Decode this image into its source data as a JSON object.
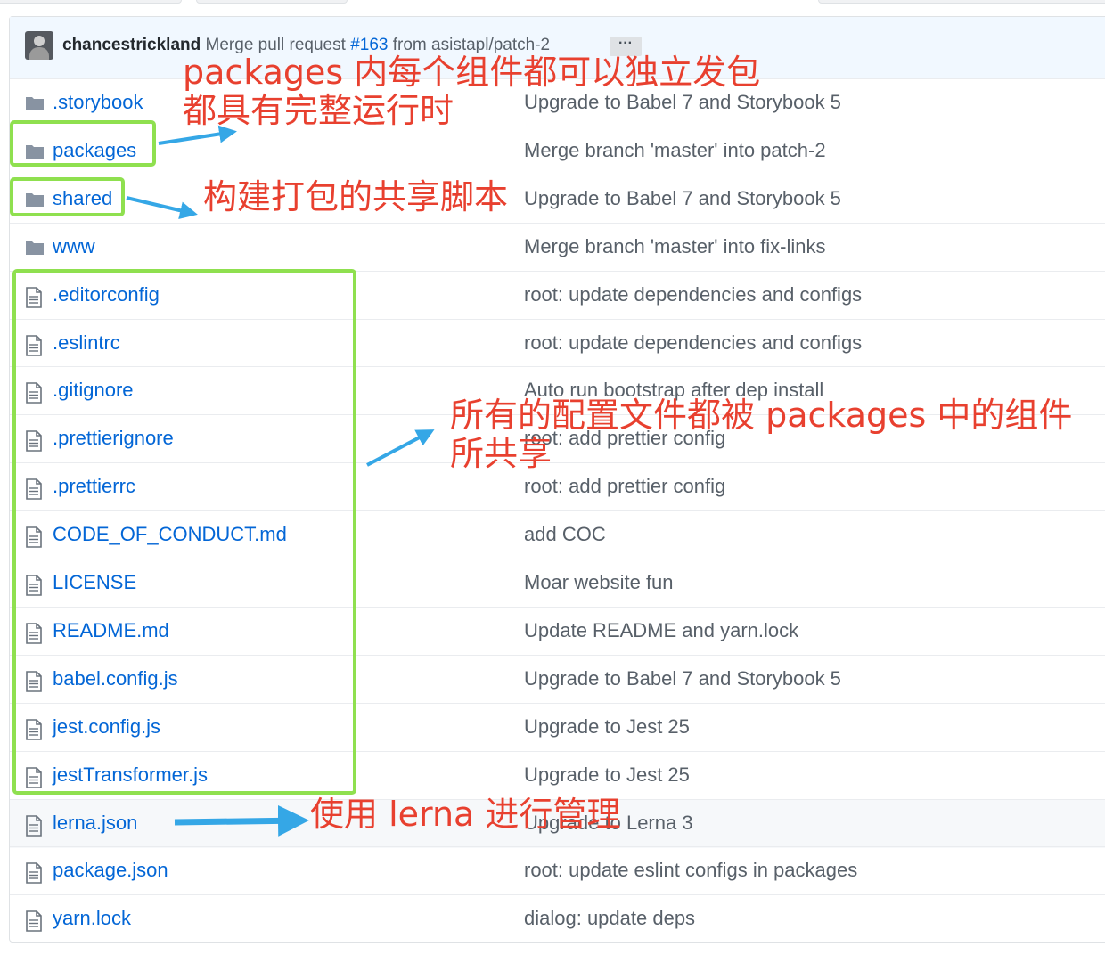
{
  "commit": {
    "author": "chancestrickland",
    "message_prefix": "Merge pull request",
    "pr_number": "#163",
    "message_suffix": "from asistapl/patch-2",
    "more_label": "···"
  },
  "files": [
    {
      "name": ".storybook",
      "type": "folder",
      "message": "Upgrade to Babel 7 and Storybook 5"
    },
    {
      "name": "packages",
      "type": "folder",
      "message": "Merge branch 'master' into patch-2"
    },
    {
      "name": "shared",
      "type": "folder",
      "message": "Upgrade to Babel 7 and Storybook 5"
    },
    {
      "name": "www",
      "type": "folder",
      "message": "Merge branch 'master' into fix-links"
    },
    {
      "name": ".editorconfig",
      "type": "file",
      "message": "root: update dependencies and configs"
    },
    {
      "name": ".eslintrc",
      "type": "file",
      "message": "root: update dependencies and configs"
    },
    {
      "name": ".gitignore",
      "type": "file",
      "message": "Auto run bootstrap after dep install"
    },
    {
      "name": ".prettierignore",
      "type": "file",
      "message": "root: add prettier config"
    },
    {
      "name": ".prettierrc",
      "type": "file",
      "message": "root: add prettier config"
    },
    {
      "name": "CODE_OF_CONDUCT.md",
      "type": "file",
      "message": "add COC"
    },
    {
      "name": "LICENSE",
      "type": "file",
      "message": "Moar website fun"
    },
    {
      "name": "README.md",
      "type": "file",
      "message": "Update README and yarn.lock"
    },
    {
      "name": "babel.config.js",
      "type": "file",
      "message": "Upgrade to Babel 7 and Storybook 5"
    },
    {
      "name": "jest.config.js",
      "type": "file",
      "message": "Upgrade to Jest 25"
    },
    {
      "name": "jestTransformer.js",
      "type": "file",
      "message": "Upgrade to Jest 25"
    },
    {
      "name": "lerna.json",
      "type": "file",
      "message": "Upgrade to Lerna 3"
    },
    {
      "name": "package.json",
      "type": "file",
      "message": "root: update eslint configs in packages"
    },
    {
      "name": "yarn.lock",
      "type": "file",
      "message": "dialog: update deps"
    }
  ],
  "annotations": {
    "packages_line1": "packages 内每个组件都可以独立发包",
    "packages_line2": "都具有完整运行时",
    "shared": "构建打包的共享脚本",
    "config_line1": "所有的配置文件都被 packages 中的组件",
    "config_line2": "所共享",
    "lerna": "使用 lerna 进行管理"
  },
  "colors": {
    "link": "#0366d6",
    "annotation": "#e8402f",
    "highlight_box": "#8fe04f",
    "arrow": "#35a7e6"
  }
}
